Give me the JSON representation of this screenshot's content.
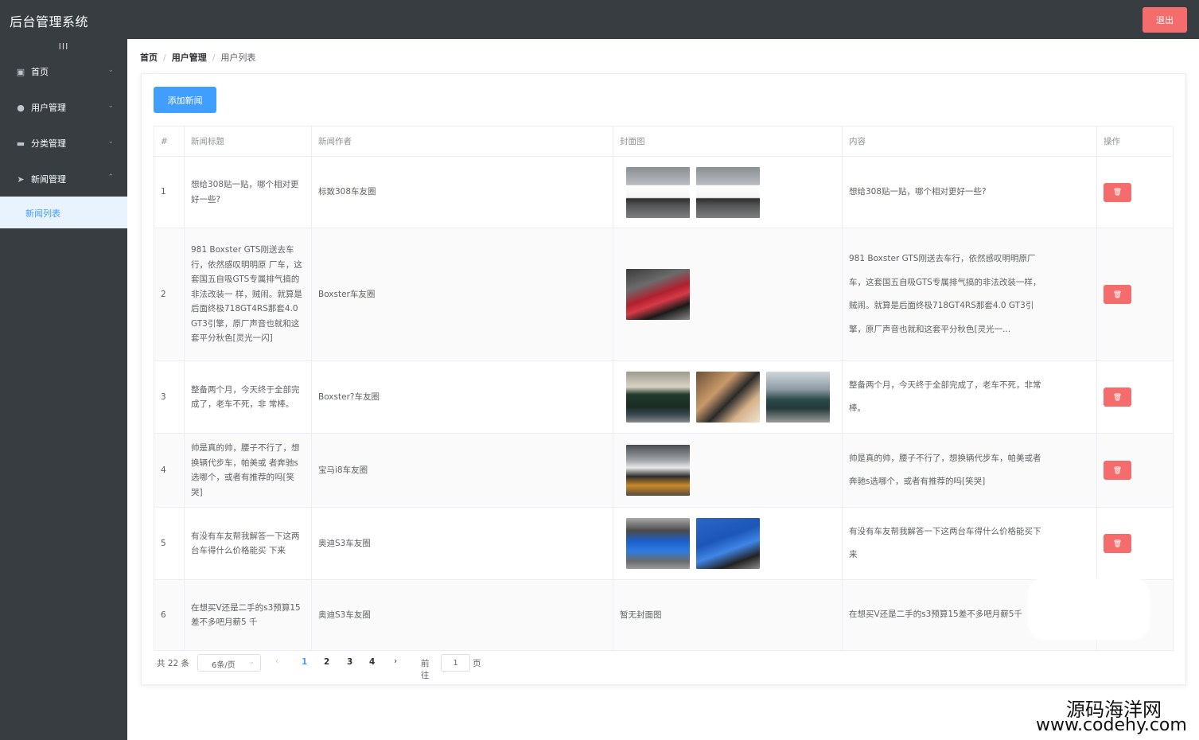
{
  "app": {
    "title": "后台管理系统",
    "logout_label": "退出",
    "collapse_glyph": "III"
  },
  "sidebar": {
    "items": [
      {
        "label": "首页",
        "icon": "home-icon",
        "glyph": "▣",
        "arrow": "⌄"
      },
      {
        "label": "用户管理",
        "icon": "user-icon",
        "glyph": "●",
        "arrow": "⌄"
      },
      {
        "label": "分类管理",
        "icon": "monitor-icon",
        "glyph": "▬",
        "arrow": "⌄"
      },
      {
        "label": "新闻管理",
        "icon": "send-icon",
        "glyph": "➤",
        "arrow": "⌃"
      }
    ],
    "submenu": {
      "label": "新闻列表"
    }
  },
  "breadcrumb": {
    "home": "首页",
    "sep": "/",
    "section": "用户管理",
    "current": "用户列表"
  },
  "toolbar": {
    "add_label": "添加新闻"
  },
  "table": {
    "headers": [
      "#",
      "新闻标题",
      "新闻作者",
      "封面图",
      "内容",
      "操作"
    ],
    "no_cover_text": "暂无封面图",
    "delete_glyph": "🗑",
    "rows": [
      {
        "index": "1",
        "title": "想给308贴一贴，哪个相对更好一些?",
        "author": "标致308车友圈",
        "content": "想给308贴一贴，哪个相对更好一些?",
        "covers": [
          "car-white",
          "car-white"
        ]
      },
      {
        "index": "2",
        "title": "981 Boxster GTS刚送去车行，依然感叹明明原 厂车，这套国五自吸GTS专属排气搞的非法改装一 样，贼闹。就算是后面终极718GT4RS那套4.0 GT3引擎，原厂声音也就和这套平分秋色[灵光一闪]",
        "author": "Boxster车友圈",
        "content": "981 Boxster GTS刚送去车行，依然感叹明明原厂车，这套国五自吸GTS专属排气搞的非法改装一样，贼闹。就算是后面终极718GT4RS那套4.0 GT3引擎，原厂声音也就和这套平分秋色[灵光一...",
        "covers": [
          "car-red"
        ]
      },
      {
        "index": "3",
        "title": "整备两个月，今天终于全部完成了，老车不死，非 常棒。",
        "author": "Boxster?车友圈",
        "content": "整备两个月，今天终于全部完成了，老车不死，非常棒。",
        "covers": [
          "car-green",
          "car-interior",
          "car-green2"
        ]
      },
      {
        "index": "4",
        "title": "帅是真的帅，腰子不行了，想换辆代步车，帕美或 者奔驰s选哪个，或者有推荐的吗[笑哭]",
        "author": "宝马i8车友圈",
        "content": "帅是真的帅，腰子不行了，想换辆代步车，帕美或者奔驰s选哪个，或者有推荐的吗[笑哭]",
        "covers": [
          "car-bmw"
        ]
      },
      {
        "index": "5",
        "title": "有没有车友帮我解答一下这两台车得什么价格能买 下来",
        "author": "奥迪S3车友圈",
        "content": "有没有车友帮我解答一下这两台车得什么价格能买下来",
        "covers": [
          "car-blue1",
          "car-blue2"
        ]
      },
      {
        "index": "6",
        "title": "在想买V还是二手的s3预算15差不多吧月薪5 千",
        "author": "奥迪S3车友圈",
        "content": "在想买V还是二手的s3预算15差不多吧月薪5千",
        "covers": []
      }
    ]
  },
  "pagination": {
    "total_label": "共 22 条",
    "page_size": "6条/页",
    "pages": [
      "1",
      "2",
      "3",
      "4"
    ],
    "current_page": "1",
    "goto_label": "前往",
    "goto_value": "1",
    "unit_label": "页",
    "prev_glyph": "‹",
    "next_glyph": "›",
    "size_arrow": "⌄"
  },
  "watermark": {
    "cn": "源码海洋网",
    "url": "www.codehy.com"
  },
  "colors": {
    "header_bg": "#373d41",
    "primary": "#409eff",
    "danger": "#f56c6c",
    "submenu_bg": "#e9f3fe"
  }
}
